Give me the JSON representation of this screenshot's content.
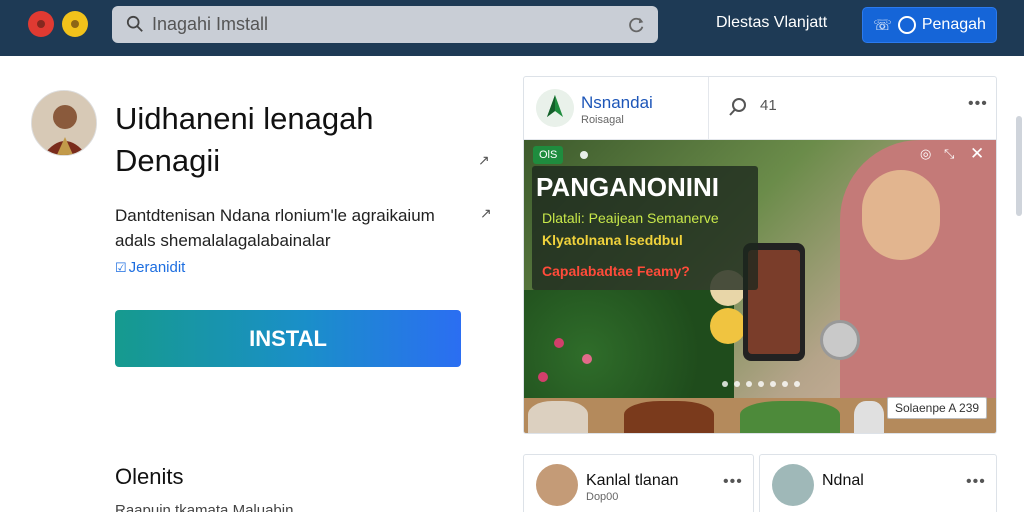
{
  "topbar": {
    "search_placeholder": "Inagahi Imstall",
    "link_label": "Dlestas Vlanjatt",
    "button_label": "Penagah"
  },
  "app": {
    "title": "Uidhaneni lenagah Denagii",
    "description": "Dantdtenisan Ndana rlonium'le agraikaium adals shemalalagalabainalar",
    "link_label": "Jeranidit",
    "install_label": "INSTAL",
    "section_title": "Olenits",
    "section_sub": "Raapujn tkamata Maluabin"
  },
  "post": {
    "brand_name": "Nsnandai",
    "brand_sub": "Roisagal",
    "count": "41",
    "media_tag": "OlS",
    "overlay_title": "PANGANONINI",
    "overlay_line1": "Dlatali: Peaijean Semanerve",
    "overlay_line2": "Klyatolnana lseddbul",
    "overlay_line3": "Capalabadtae Feamy?",
    "tooltip": "Solaenpe A 239"
  },
  "cards": [
    {
      "name": "Kanlal tlanan",
      "sub": "Dop00"
    },
    {
      "name": "Ndnal",
      "sub": ""
    }
  ],
  "colors": {
    "topbar": "#1e3a55",
    "accent": "#1565d8",
    "install_start": "#169a8e",
    "install_end": "#2b6ef2"
  }
}
